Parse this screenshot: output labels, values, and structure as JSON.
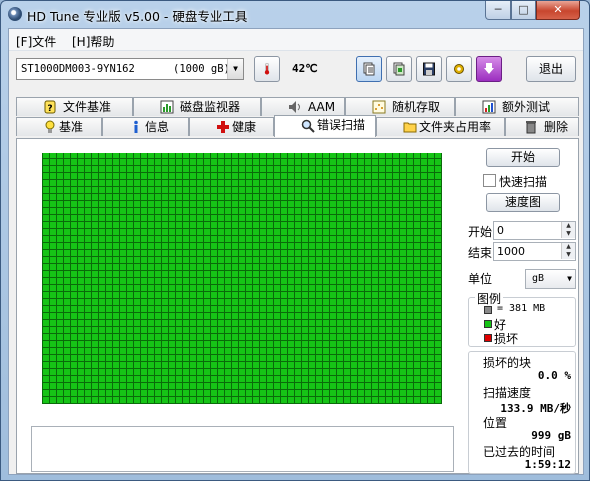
{
  "window": {
    "title": "HD Tune 专业版 v5.00 - 硬盘专业工具",
    "min_label": "─",
    "max_label": "□",
    "close_label": "✕"
  },
  "menu": {
    "file": "[F]文件",
    "help": "[H]帮助"
  },
  "toolbar": {
    "drive": "ST1000DM003-9YN162",
    "drive_size": "(1000 gB)",
    "temperature": "42℃",
    "exit_label": "退出",
    "icons": [
      "copy-text-icon",
      "copy-icon",
      "save-icon",
      "options-icon",
      "download-icon"
    ]
  },
  "tabs_top": [
    "文件基准",
    "磁盘监视器",
    "AAM",
    "随机存取",
    "额外测试"
  ],
  "tabs_bottom": [
    "基准",
    "信息",
    "健康",
    "错误扫描",
    "文件夹占用率",
    "删除"
  ],
  "active_tab": "错误扫描",
  "scan": {
    "start_button": "开始",
    "quick_scan_label": "快速扫描",
    "quick_scan_checked": false,
    "speed_map_button": "速度图",
    "start_label": "开始",
    "start_value": "0",
    "end_label": "结束",
    "end_value": "1000",
    "unit_label": "单位",
    "unit_value": "gB",
    "legend_title": "图例",
    "legend_block": "= 381 MB",
    "legend_good": "好",
    "legend_bad": "损坏",
    "colors": {
      "good": "#16c416",
      "bad": "#e00000",
      "block": "#8a8a8a"
    }
  },
  "stats": {
    "damaged_label": "损坏的块",
    "damaged_value": "0.0 %",
    "speed_label": "扫描速度",
    "speed_value": "133.9 MB/秒",
    "position_label": "位置",
    "position_value": "999 gB",
    "elapsed_label": "已过去的时间",
    "elapsed_value": "1:59:12"
  }
}
